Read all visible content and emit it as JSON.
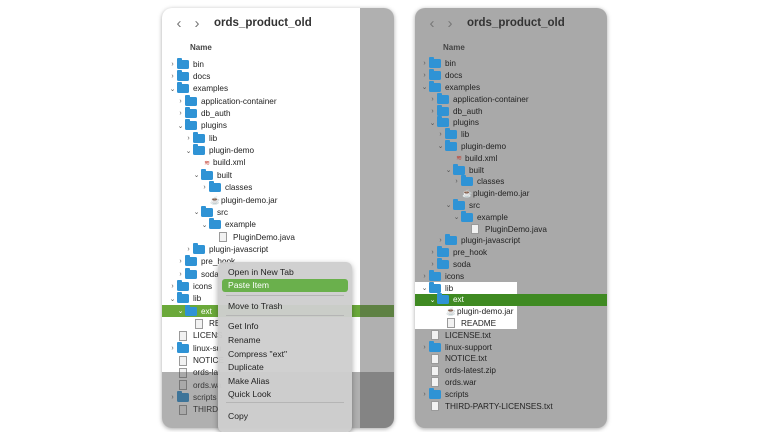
{
  "left": {
    "title": "ords_product_old",
    "col_header": "Name",
    "rows": [
      {
        "label": "bin",
        "type": "folder",
        "chev": "›"
      },
      {
        "label": "docs",
        "type": "folder",
        "chev": "›"
      },
      {
        "label": "examples",
        "type": "folder",
        "chev": "⌄"
      },
      {
        "label": "application-container",
        "type": "folder",
        "chev": "›"
      },
      {
        "label": "db_auth",
        "type": "folder",
        "chev": "›"
      },
      {
        "label": "plugins",
        "type": "folder",
        "chev": "⌄"
      },
      {
        "label": "lib",
        "type": "folder",
        "chev": "›"
      },
      {
        "label": "plugin-demo",
        "type": "folder",
        "chev": "⌄"
      },
      {
        "label": "build.xml",
        "type": "xml",
        "chev": ""
      },
      {
        "label": "built",
        "type": "folder",
        "chev": "⌄"
      },
      {
        "label": "classes",
        "type": "folder",
        "chev": "›"
      },
      {
        "label": "plugin-demo.jar",
        "type": "jar",
        "chev": ""
      },
      {
        "label": "src",
        "type": "folder",
        "chev": "⌄"
      },
      {
        "label": "example",
        "type": "folder",
        "chev": "⌄"
      },
      {
        "label": "PluginDemo.java",
        "type": "file",
        "chev": ""
      },
      {
        "label": "plugin-javascript",
        "type": "folder",
        "chev": "›"
      },
      {
        "label": "pre_hook",
        "type": "folder",
        "chev": "›"
      },
      {
        "label": "soda",
        "type": "folder",
        "chev": "›"
      },
      {
        "label": "icons",
        "type": "folder",
        "chev": "›"
      },
      {
        "label": "lib",
        "type": "folder",
        "chev": "⌄"
      },
      {
        "label": "ext",
        "type": "folder",
        "chev": "⌄"
      },
      {
        "label": "RE",
        "type": "file",
        "chev": ""
      },
      {
        "label": "LICENS",
        "type": "file",
        "chev": ""
      },
      {
        "label": "linux-su",
        "type": "folder",
        "chev": "›"
      },
      {
        "label": "NOTICE",
        "type": "file",
        "chev": ""
      },
      {
        "label": "ords-lat",
        "type": "file",
        "chev": ""
      },
      {
        "label": "ords.wa",
        "type": "file",
        "chev": ""
      },
      {
        "label": "scripts",
        "type": "folder",
        "chev": "›"
      },
      {
        "label": "THIRD-",
        "type": "file",
        "chev": ""
      }
    ]
  },
  "context_menu": {
    "items": [
      "Open in New Tab",
      "Paste Item",
      "Move to Trash",
      "Get Info",
      "Rename",
      "Compress \"ext\"",
      "Duplicate",
      "Make Alias",
      "Quick Look",
      "Copy"
    ]
  },
  "right": {
    "title": "ords_product_old",
    "col_header": "Name",
    "rows": [
      {
        "label": "bin",
        "type": "folder",
        "chev": "›"
      },
      {
        "label": "docs",
        "type": "folder",
        "chev": "›"
      },
      {
        "label": "examples",
        "type": "folder",
        "chev": "⌄"
      },
      {
        "label": "application-container",
        "type": "folder",
        "chev": "›"
      },
      {
        "label": "db_auth",
        "type": "folder",
        "chev": "›"
      },
      {
        "label": "plugins",
        "type": "folder",
        "chev": "⌄"
      },
      {
        "label": "lib",
        "type": "folder",
        "chev": "›"
      },
      {
        "label": "plugin-demo",
        "type": "folder",
        "chev": "⌄"
      },
      {
        "label": "build.xml",
        "type": "xml",
        "chev": ""
      },
      {
        "label": "built",
        "type": "folder",
        "chev": "⌄"
      },
      {
        "label": "classes",
        "type": "folder",
        "chev": "›"
      },
      {
        "label": "plugin-demo.jar",
        "type": "jar",
        "chev": ""
      },
      {
        "label": "src",
        "type": "folder",
        "chev": "⌄"
      },
      {
        "label": "example",
        "type": "folder",
        "chev": "⌄"
      },
      {
        "label": "PluginDemo.java",
        "type": "file",
        "chev": ""
      },
      {
        "label": "plugin-javascript",
        "type": "folder",
        "chev": "›"
      },
      {
        "label": "pre_hook",
        "type": "folder",
        "chev": "›"
      },
      {
        "label": "soda",
        "type": "folder",
        "chev": "›"
      },
      {
        "label": "icons",
        "type": "folder",
        "chev": "›"
      },
      {
        "label": "lib",
        "type": "folder",
        "chev": "⌄"
      },
      {
        "label": "ext",
        "type": "folder",
        "chev": "⌄"
      },
      {
        "label": "plugin-demo.jar",
        "type": "jar",
        "chev": ""
      },
      {
        "label": "README",
        "type": "file",
        "chev": ""
      },
      {
        "label": "LICENSE.txt",
        "type": "file",
        "chev": ""
      },
      {
        "label": "linux-support",
        "type": "folder",
        "chev": "›"
      },
      {
        "label": "NOTICE.txt",
        "type": "file",
        "chev": ""
      },
      {
        "label": "ords-latest.zip",
        "type": "file",
        "chev": ""
      },
      {
        "label": "ords.war",
        "type": "file",
        "chev": ""
      },
      {
        "label": "scripts",
        "type": "folder",
        "chev": "›"
      },
      {
        "label": "THIRD-PARTY-LICENSES.txt",
        "type": "file",
        "chev": ""
      }
    ]
  },
  "nav": {
    "back": "‹",
    "forward": "›"
  }
}
